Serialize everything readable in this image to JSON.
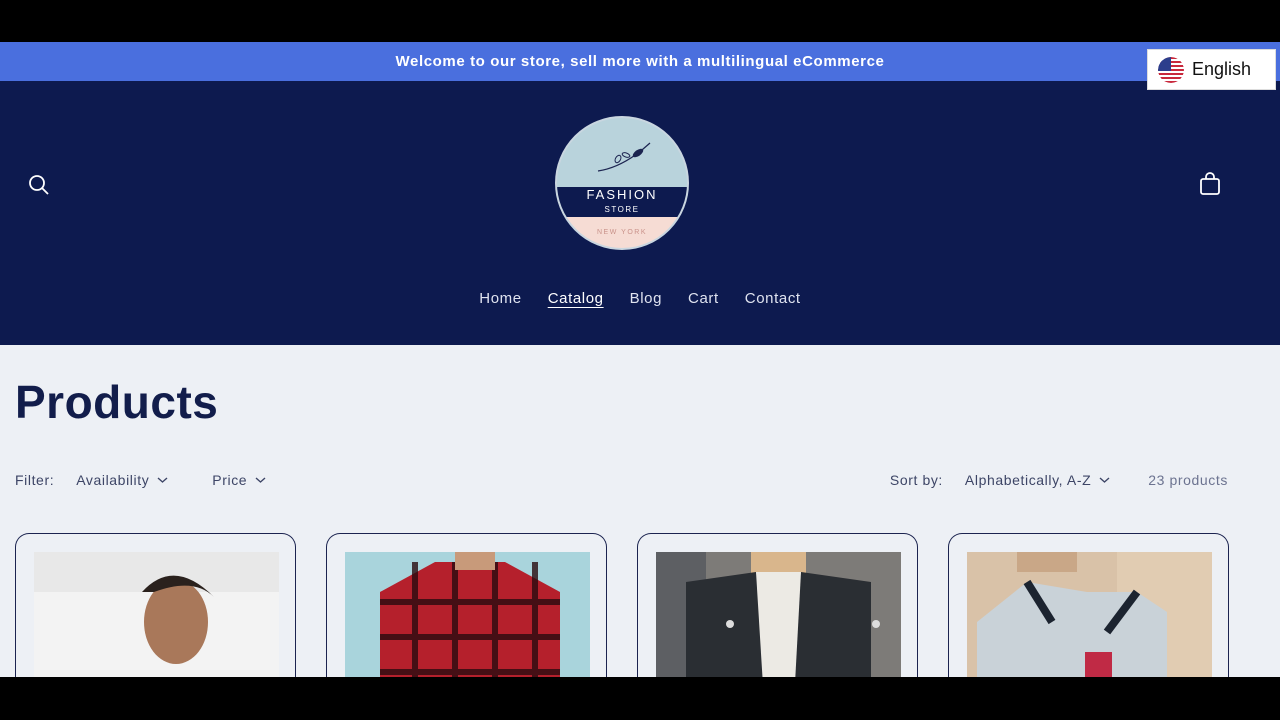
{
  "announcement": {
    "text": "Welcome to our store, sell more with a multilingual eCommerce"
  },
  "language_selector": {
    "label": "English",
    "flag_icon": "us-flag-icon"
  },
  "header": {
    "logo": {
      "line1": "FASHION",
      "line2": "STORE",
      "line3": "NEW YORK"
    },
    "nav": [
      {
        "label": "Home",
        "active": false
      },
      {
        "label": "Catalog",
        "active": true
      },
      {
        "label": "Blog",
        "active": false
      },
      {
        "label": "Cart",
        "active": false
      },
      {
        "label": "Contact",
        "active": false
      }
    ]
  },
  "main": {
    "title": "Products",
    "filter_label": "Filter:",
    "filters": [
      "Availability",
      "Price"
    ],
    "sort_label": "Sort by:",
    "sort_value": "Alphabetically, A-Z",
    "product_count": "23 products"
  },
  "colors": {
    "announcement_bg": "#4a6fde",
    "header_bg": "#0d1a4f",
    "page_bg": "#edf0f5",
    "title": "#121d4b"
  }
}
